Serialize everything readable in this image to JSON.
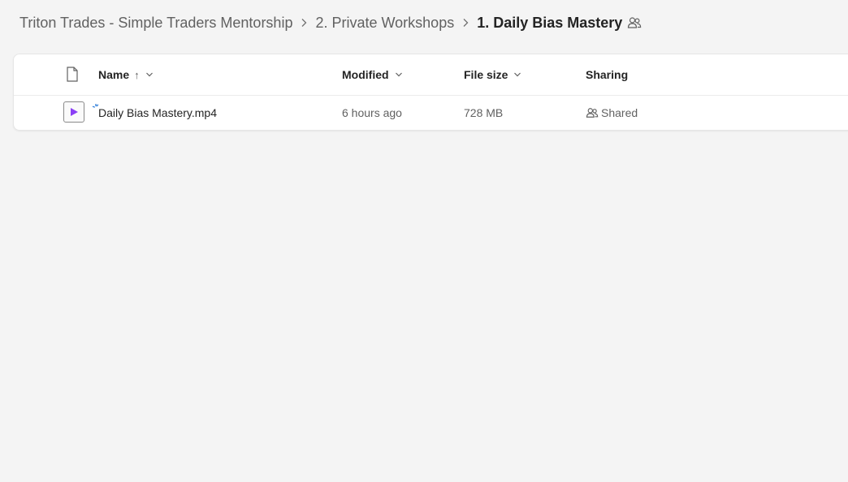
{
  "breadcrumb": {
    "items": [
      {
        "label": "Triton Trades - Simple Traders Mentorship"
      },
      {
        "label": "2. Private Workshops"
      },
      {
        "label": "1. Daily Bias Mastery"
      }
    ]
  },
  "table": {
    "columns": {
      "name": "Name",
      "sort_indicator": "↑",
      "modified": "Modified",
      "file_size": "File size",
      "sharing": "Sharing"
    },
    "rows": [
      {
        "name": "Daily Bias Mastery.mp4",
        "modified": "6 hours ago",
        "file_size": "728 MB",
        "sharing": "Shared",
        "icon": "video-file-icon"
      }
    ]
  },
  "colors": {
    "background": "#f4f4f4",
    "card": "#ffffff",
    "video_accent": "#8a3ff5",
    "new_indicator": "#2b7bd8"
  }
}
